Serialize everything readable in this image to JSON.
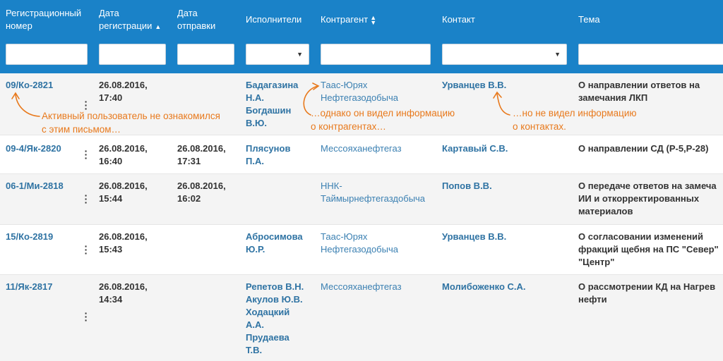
{
  "columns": {
    "reg_no": [
      "Регистрационный",
      "номер"
    ],
    "reg_date": [
      "Дата",
      "регистрации"
    ],
    "sent_date": [
      "Дата",
      "отправки"
    ],
    "executors": "Исполнители",
    "counterparty": "Контрагент",
    "contact": "Контакт",
    "topic": "Тема"
  },
  "sort_icons": {
    "reg_date": "▲",
    "counterparty": "▲▼"
  },
  "dropdown_caret": "▼",
  "rows": [
    {
      "reg_no": "09/Ко-2821",
      "reg_date": [
        "26.08.2016,",
        "17:40"
      ],
      "sent_date": [],
      "executors": [
        "Бадагазина",
        "Н.А.",
        "Богдашин",
        "В.Ю."
      ],
      "counterparty": [
        "Таас-Юрях",
        "Нефтегазодобыча"
      ],
      "contact": "Урванцев В.В.",
      "topic": [
        "О направлении ответов на",
        "замечания ЛКП"
      ]
    },
    {
      "reg_no": "09-4/Як-2820",
      "reg_date": [
        "26.08.2016,",
        "16:40"
      ],
      "sent_date": [
        "26.08.2016,",
        "17:31"
      ],
      "executors": [
        "Плясунов",
        "П.А."
      ],
      "counterparty": [
        "Мессояханефтегаз"
      ],
      "contact": "Картавый С.В.",
      "topic": [
        "О направлении СД (Р-5,Р-28)"
      ]
    },
    {
      "reg_no": "06-1/Ми-2818",
      "reg_date": [
        "26.08.2016,",
        "15:44"
      ],
      "sent_date": [
        "26.08.2016,",
        "16:02"
      ],
      "executors": [],
      "counterparty": [
        "ННК-",
        "Таймырнефтегаздобыча"
      ],
      "contact": "Попов В.В.",
      "topic": [
        "О передаче ответов на замеча",
        "ИИ и откорректированных",
        "материалов"
      ]
    },
    {
      "reg_no": "15/Ко-2819",
      "reg_date": [
        "26.08.2016,",
        "15:43"
      ],
      "sent_date": [],
      "executors": [
        "Абросимова",
        "Ю.Р."
      ],
      "counterparty": [
        "Таас-Юрях",
        "Нефтегазодобыча"
      ],
      "contact": "Урванцев В.В.",
      "topic": [
        "О согласовании изменений",
        "фракций щебня на ПС \"Север\"",
        "\"Центр\""
      ]
    },
    {
      "reg_no": "11/Як-2817",
      "reg_date": [
        "26.08.2016,",
        "14:34"
      ],
      "sent_date": [],
      "executors": [
        "Репетов В.Н.",
        "Акулов Ю.В.",
        "Ходацкий",
        "А.А.",
        "Прудаева",
        "Т.В."
      ],
      "counterparty": [
        "Мессояханефтегаз"
      ],
      "contact": "Молибоженко С.А.",
      "topic": [
        "О рассмотрении КД на Нагрев",
        "нефти"
      ]
    }
  ],
  "annotations": {
    "user": [
      "Активный пользователь не ознакомился",
      "с этим письмом…"
    ],
    "counterparty": [
      "…однако он видел информацию",
      "о контрагентах…"
    ],
    "contact": [
      "…но не видел информацию",
      "о контактах."
    ]
  },
  "colors": {
    "header_bg": "#1a82c8",
    "link": "#2f73a3",
    "annotation": "#e8791c",
    "row_shade": "#f4f4f4"
  }
}
